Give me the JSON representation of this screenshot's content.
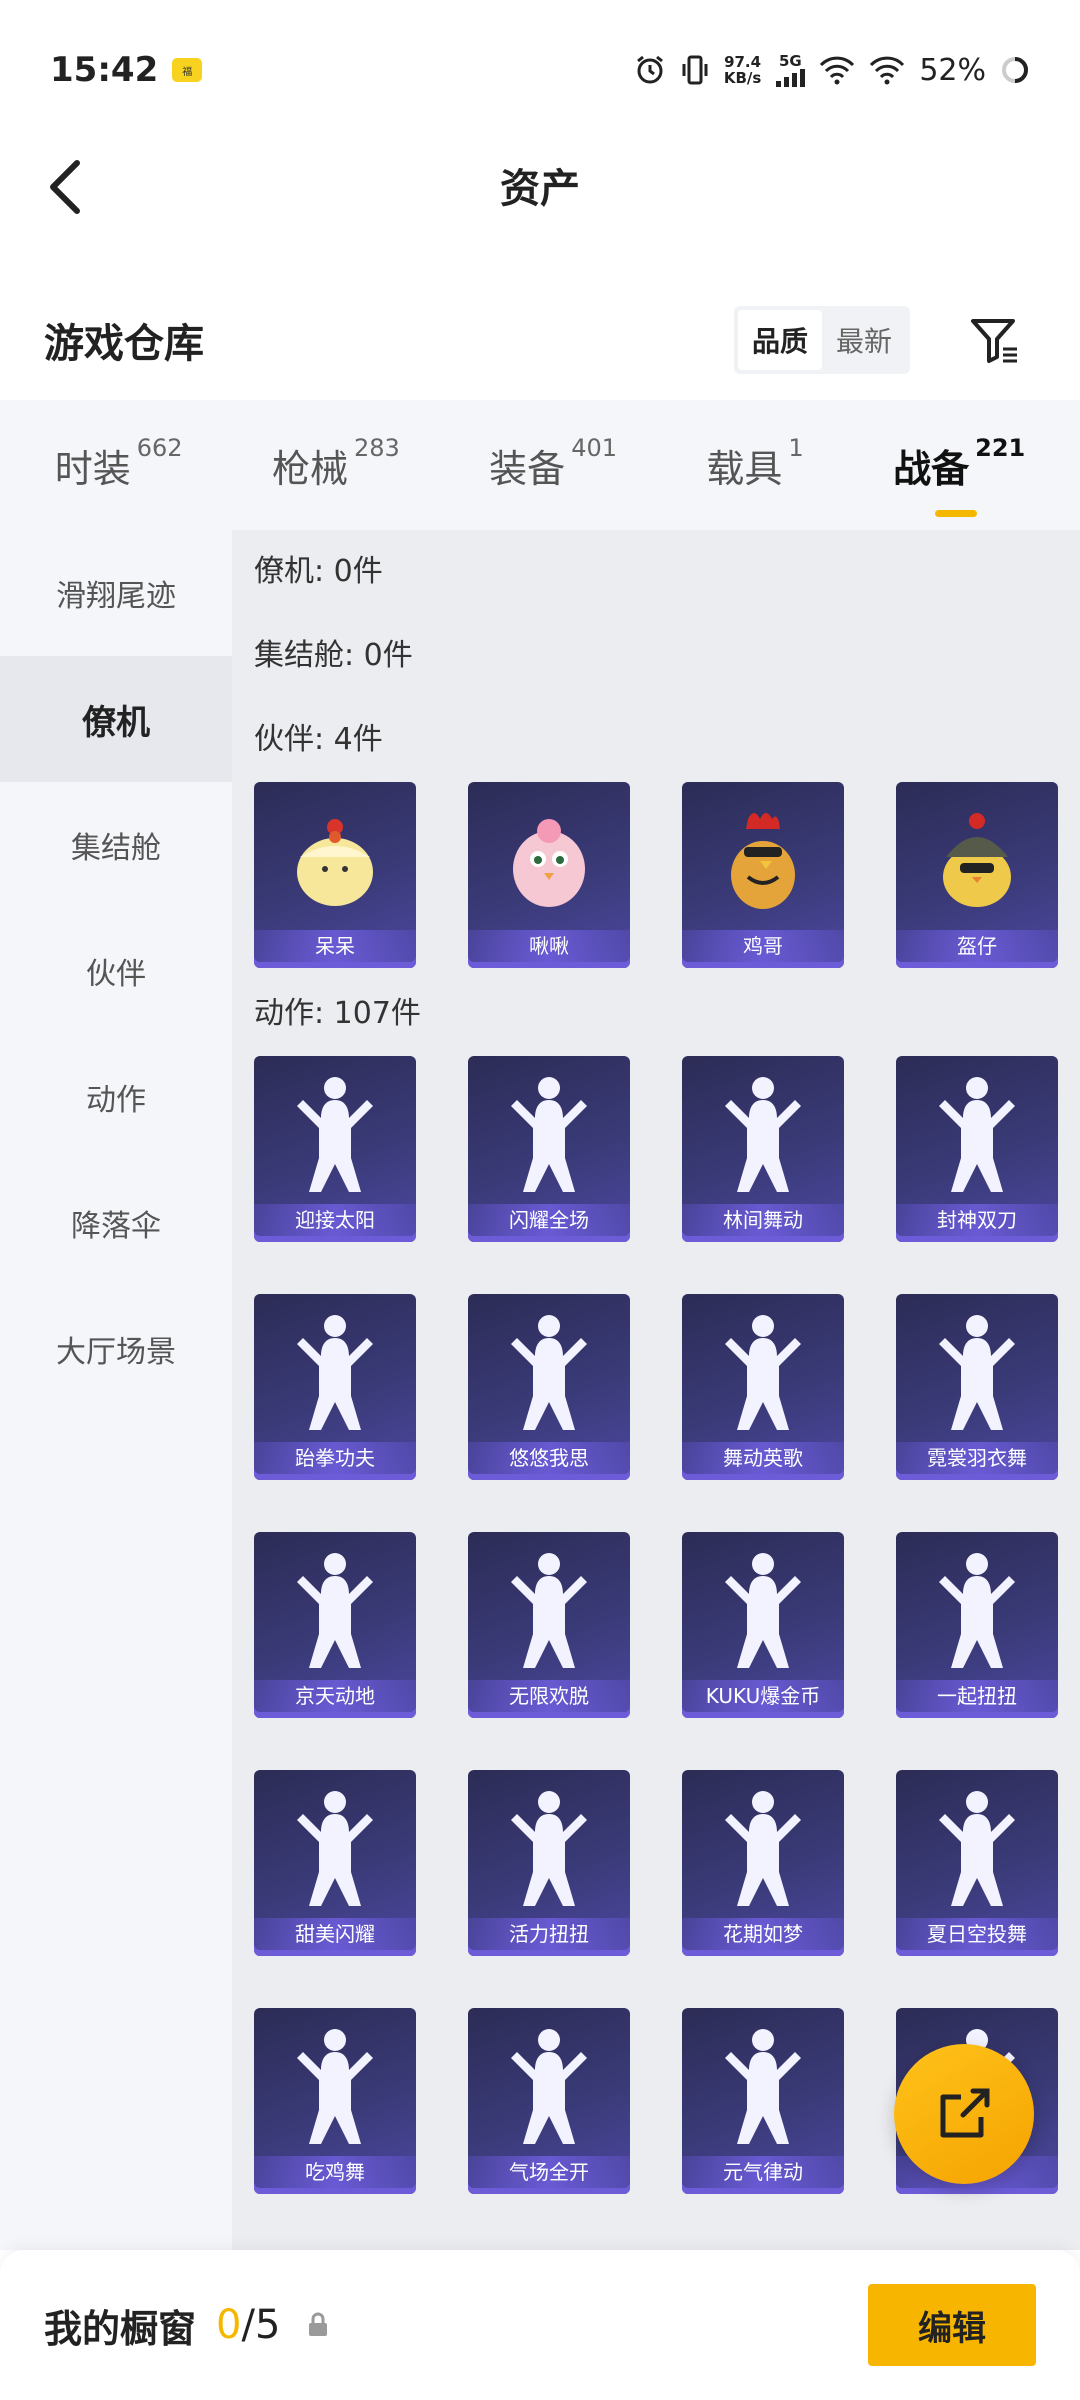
{
  "status_bar": {
    "time": "15:42",
    "badge": "福",
    "net_speed": "97.4",
    "net_unit": "KB/s",
    "net_type": "5G",
    "battery": "52%"
  },
  "header": {
    "title": "资产"
  },
  "warehouse": {
    "title": "游戏仓库",
    "sort_options": [
      "品质",
      "最新"
    ],
    "active_sort": "品质"
  },
  "category_tabs": [
    {
      "label": "时装",
      "count": "662",
      "active": false
    },
    {
      "label": "枪械",
      "count": "283",
      "active": false
    },
    {
      "label": "装备",
      "count": "401",
      "active": false
    },
    {
      "label": "载具",
      "count": "1",
      "active": false
    },
    {
      "label": "战备",
      "count": "221",
      "active": true
    }
  ],
  "sidebar": {
    "items": [
      {
        "label": "滑翔尾迹",
        "active": false
      },
      {
        "label": "僚机",
        "active": true
      },
      {
        "label": "集结舱",
        "active": false
      },
      {
        "label": "伙伴",
        "active": false
      },
      {
        "label": "动作",
        "active": false
      },
      {
        "label": "降落伞",
        "active": false
      },
      {
        "label": "大厅场景",
        "active": false
      }
    ]
  },
  "sections": {
    "wingman": "僚机: 0件",
    "capsule": "集结舱: 0件",
    "companion": "伙伴: 4件",
    "actions": "动作: 107件"
  },
  "companions": [
    {
      "name": "呆呆",
      "icon": "chick-icon"
    },
    {
      "name": "啾啾",
      "icon": "pink-bird-icon"
    },
    {
      "name": "鸡哥",
      "icon": "rooster-icon"
    },
    {
      "name": "盔仔",
      "icon": "helmet-chick-icon"
    }
  ],
  "actions": [
    {
      "name": "迎接太阳"
    },
    {
      "name": "闪耀全场"
    },
    {
      "name": "林间舞动"
    },
    {
      "name": "封神双刀"
    },
    {
      "name": "跆拳功夫"
    },
    {
      "name": "悠悠我思"
    },
    {
      "name": "舞动英歌"
    },
    {
      "name": "霓裳羽衣舞"
    },
    {
      "name": "京天动地"
    },
    {
      "name": "无限欢脱"
    },
    {
      "name": "KUKU爆金币"
    },
    {
      "name": "一起扭扭"
    },
    {
      "name": "甜美闪耀"
    },
    {
      "name": "活力扭扭"
    },
    {
      "name": "花期如梦"
    },
    {
      "name": "夏日空投舞"
    },
    {
      "name": "吃鸡舞"
    },
    {
      "name": "气场全开"
    },
    {
      "name": "元气律动"
    },
    {
      "name": "场"
    }
  ],
  "bottom_bar": {
    "label": "我的橱窗",
    "current": "0",
    "total": "/5",
    "edit_label": "编辑"
  },
  "colors": {
    "accent": "#f5b800",
    "card_dark": "#2c2c56",
    "card_light": "#4c48a0"
  }
}
